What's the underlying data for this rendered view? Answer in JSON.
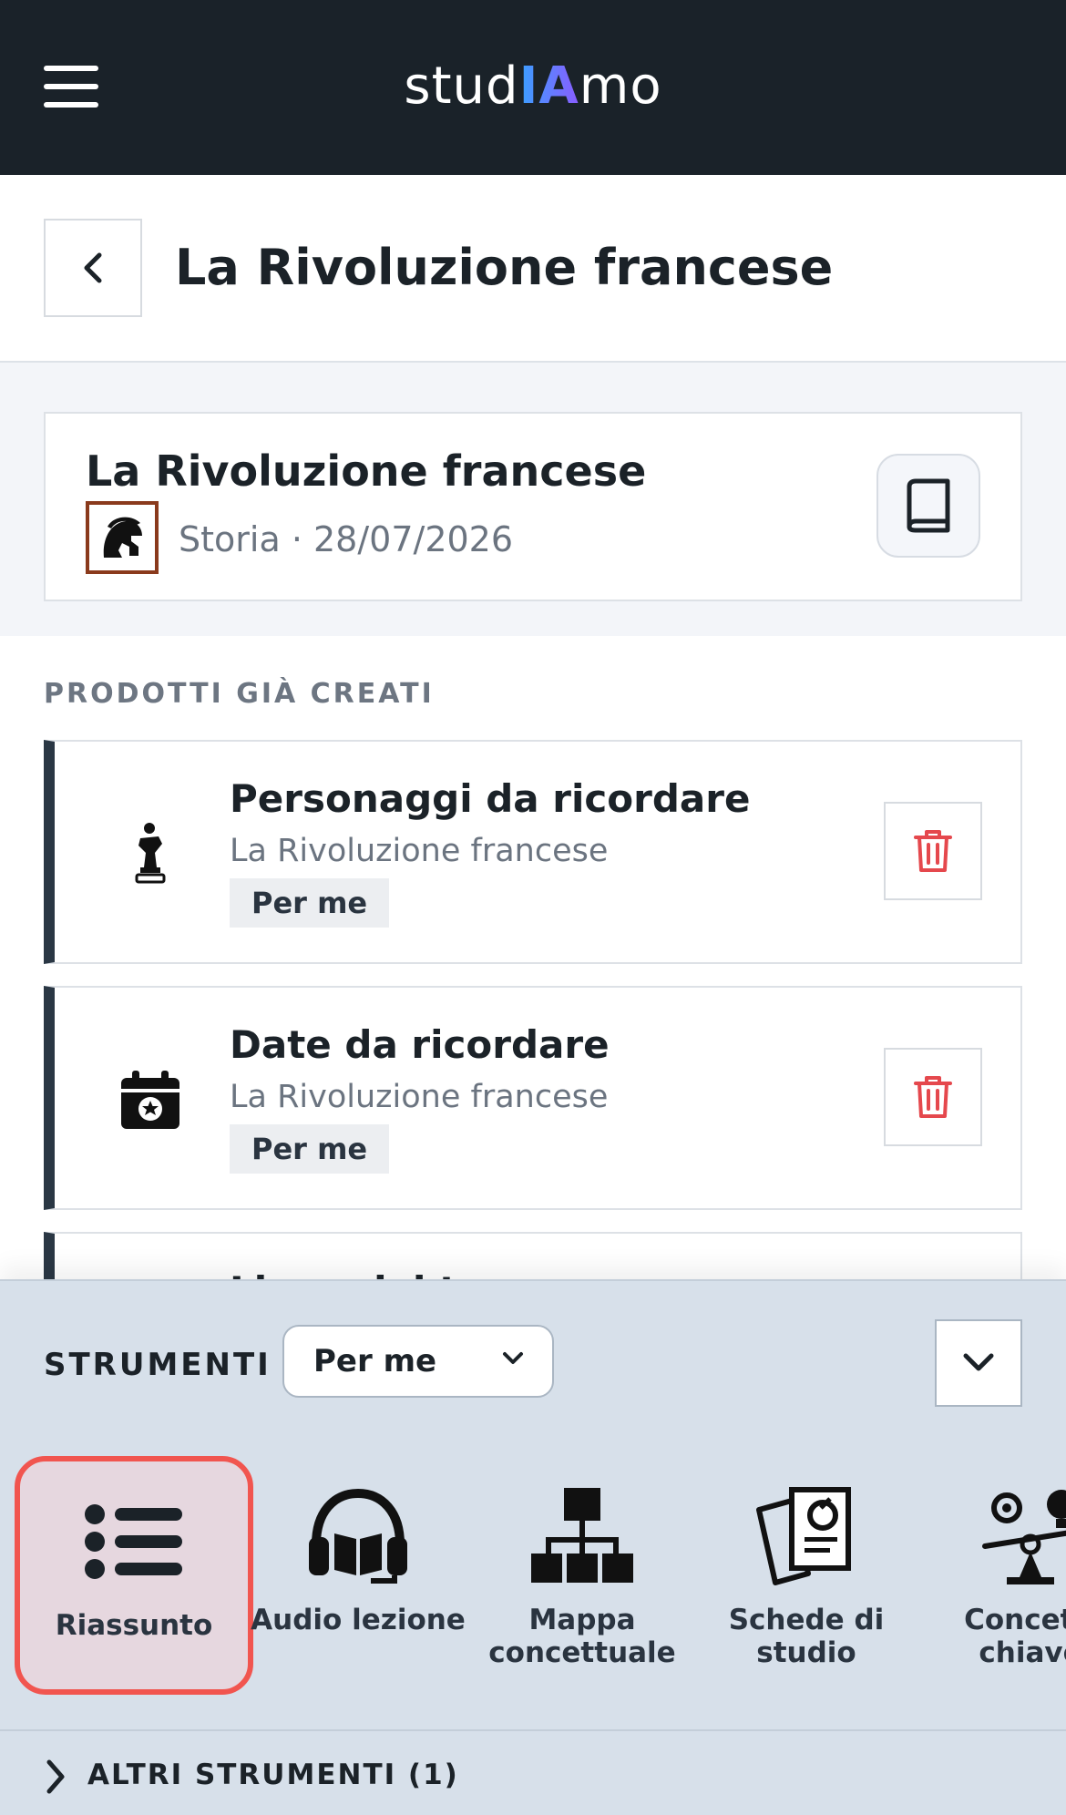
{
  "app": {
    "logo_left": "stud",
    "logo_ia": "IA",
    "logo_right": "mo"
  },
  "header": {
    "title": "La Rivoluzione francese"
  },
  "lesson": {
    "title": "La Rivoluzione francese",
    "subject": "Storia",
    "separator": " · ",
    "date": "28/07/2026"
  },
  "products": {
    "section_label": "PRODOTTI GIÀ CREATI",
    "items": [
      {
        "title": "Personaggi da ricordare",
        "subtitle": "La Rivoluzione francese",
        "tag": "Per me",
        "icon": "chess-piece-icon"
      },
      {
        "title": "Date da ricordare",
        "subtitle": "La Rivoluzione francese",
        "tag": "Per me",
        "icon": "calendar-star-icon"
      }
    ],
    "partial_title": "Linea del tempo"
  },
  "tools": {
    "label": "STRUMENTI",
    "mode_selected": "Per me",
    "items": [
      {
        "label": "Riassunto",
        "icon": "list-icon",
        "selected": true
      },
      {
        "label": "Audio lezione",
        "icon": "headphones-book-icon"
      },
      {
        "label": "Mappa concettuale",
        "icon": "sitemap-icon"
      },
      {
        "label": "Schede di studio",
        "icon": "study-cards-icon"
      },
      {
        "label": "Concetti chiave",
        "icon": "balance-ideas-icon"
      }
    ],
    "more_tools": "ALTRI STRUMENTI (1)"
  },
  "colors": {
    "topbar": "#1a2229",
    "accent_red": "#e5484d",
    "selection": "#f1554f"
  }
}
